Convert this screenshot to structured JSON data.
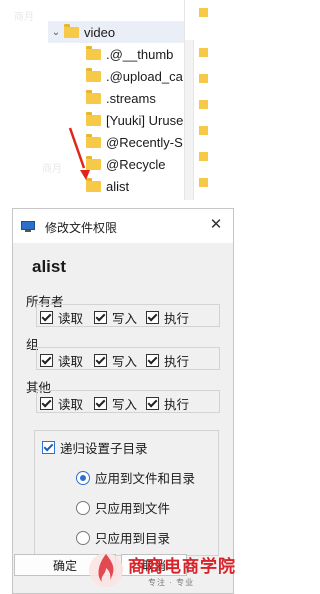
{
  "explorer": {
    "parent_folder": "video",
    "subfolders": [
      ".@__thumb",
      ".@upload_ca",
      ".streams",
      "[Yuuki] Uruse",
      "@Recently-S",
      "@Recycle",
      "alist"
    ]
  },
  "dialog": {
    "title": "修改文件权限",
    "close_label": "✕",
    "item_name": "alist",
    "groups": [
      {
        "label": "所有者",
        "read": "读取",
        "write": "写入",
        "exec": "执行"
      },
      {
        "label": "组",
        "read": "读取",
        "write": "写入",
        "exec": "执行"
      },
      {
        "label": "其他",
        "read": "读取",
        "write": "写入",
        "exec": "执行"
      }
    ],
    "recursive": {
      "label": "递归设置子目录",
      "checked": true,
      "options": [
        "应用到文件和目录",
        "只应用到文件",
        "只应用到目录"
      ],
      "selected_index": 0
    },
    "ok_label": "确定",
    "cancel_label": "取消"
  },
  "watermark": {
    "brand": "商商电商学院",
    "tagline": "专注 · 专业"
  },
  "colors": {
    "folder": "#f7c948",
    "accent": "#2f6fcf",
    "arrow": "#e1251b",
    "logo_red": "#d8232a"
  }
}
